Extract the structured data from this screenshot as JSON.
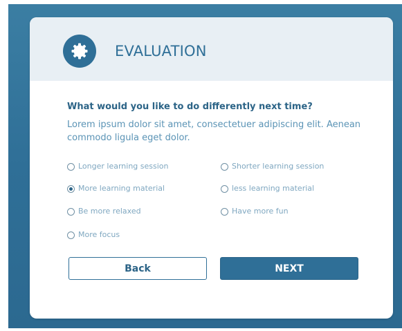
{
  "header": {
    "title": "EVALUATION",
    "icon": "gear-icon"
  },
  "question": {
    "title": "What would you like to do differently next time?",
    "description": "Lorem ipsum dolor sit amet, consectetuer adipiscing elit. Aenean commodo ligula eget dolor."
  },
  "options": [
    {
      "label": "Longer learning session",
      "checked": false
    },
    {
      "label": "Shorter learning session",
      "checked": false
    },
    {
      "label": "More learning material",
      "checked": true
    },
    {
      "label": "less learning material",
      "checked": false
    },
    {
      "label": "Be more relaxed",
      "checked": false
    },
    {
      "label": "Have more fun",
      "checked": false
    },
    {
      "label": "More focus",
      "checked": false
    }
  ],
  "buttons": {
    "back_label": "Back",
    "next_label": "NEXT"
  },
  "colors": {
    "primary": "#2f6f97",
    "header_bg": "#e8eff4",
    "text_light": "#7fa7c0"
  }
}
